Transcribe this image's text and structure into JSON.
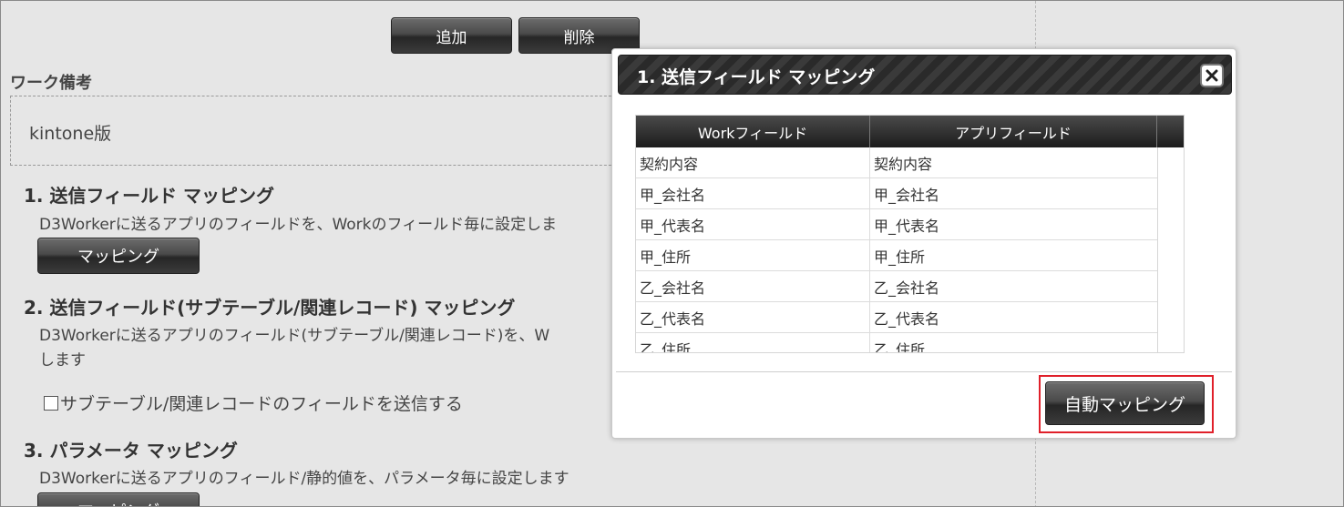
{
  "toolbar": {
    "add_label": "追加",
    "delete_label": "削除"
  },
  "memo": {
    "label": "ワーク備考",
    "value": "kintone版"
  },
  "sections": [
    {
      "title": "1. 送信フィールド マッピング",
      "description": "D3Workerに送るアプリのフィールドを、Workのフィールド毎に設定しま",
      "button_label": "マッピング"
    },
    {
      "title": "2. 送信フィールド(サブテーブル/関連レコード) マッピング",
      "description_line1": "D3Workerに送るアプリのフィールド(サブテーブル/関連レコード)を、W",
      "description_line2": "します",
      "checkbox_label": "サブテーブル/関連レコードのフィールドを送信する"
    },
    {
      "title": "3. パラメータ マッピング",
      "description": "D3Workerに送るアプリのフィールド/静的値を、パラメータ毎に設定します",
      "button_label": "マッピング"
    }
  ],
  "modal": {
    "title": "1. 送信フィールド マッピング",
    "columns": [
      "Workフィールド",
      "アプリフィールド"
    ],
    "rows": [
      [
        "契約内容",
        "契約内容"
      ],
      [
        "甲_会社名",
        "甲_会社名"
      ],
      [
        "甲_代表名",
        "甲_代表名"
      ],
      [
        "甲_住所",
        "甲_住所"
      ],
      [
        "乙_会社名",
        "乙_会社名"
      ],
      [
        "乙_代表名",
        "乙_代表名"
      ],
      [
        "乙_住所",
        "乙_住所"
      ]
    ],
    "auto_mapping_label": "自動マッピング"
  },
  "colors": {
    "highlight": "#e0202a",
    "header_dark": "#2a2a2a"
  },
  "icons": {
    "close": "close-icon"
  }
}
